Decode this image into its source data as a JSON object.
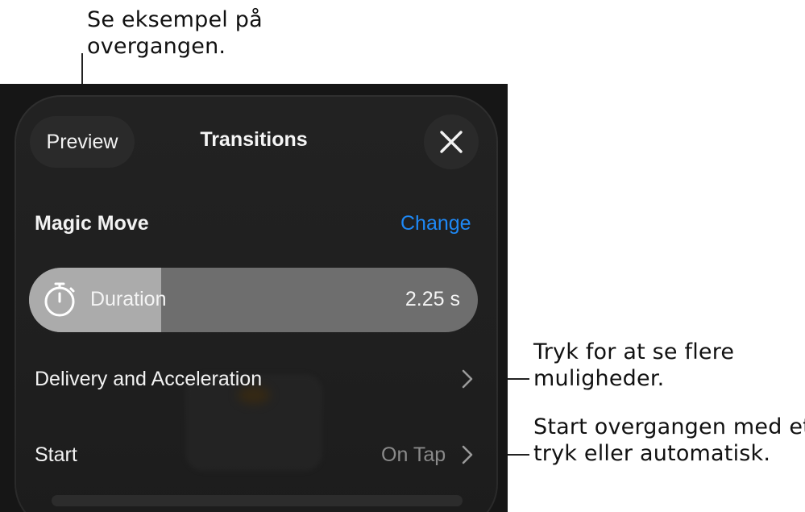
{
  "callouts": {
    "preview": [
      "Se eksempel på",
      "overgangen."
    ],
    "delivery": [
      "Tryk for at se flere",
      "muligheder."
    ],
    "start": [
      "Start overgangen med et",
      "tryk eller automatisk."
    ]
  },
  "header": {
    "preview_label": "Preview",
    "title": "Transitions",
    "close_icon": "close-icon"
  },
  "effect": {
    "name": "Magic Move",
    "change_label": "Change",
    "accent": "#1e88f5"
  },
  "duration": {
    "label": "Duration",
    "value": "2.25 s",
    "fill_fraction": 0.294,
    "icon": "stopwatch-icon"
  },
  "rows": {
    "delivery_label": "Delivery and Acceleration",
    "start_label": "Start",
    "start_value": "On Tap"
  }
}
